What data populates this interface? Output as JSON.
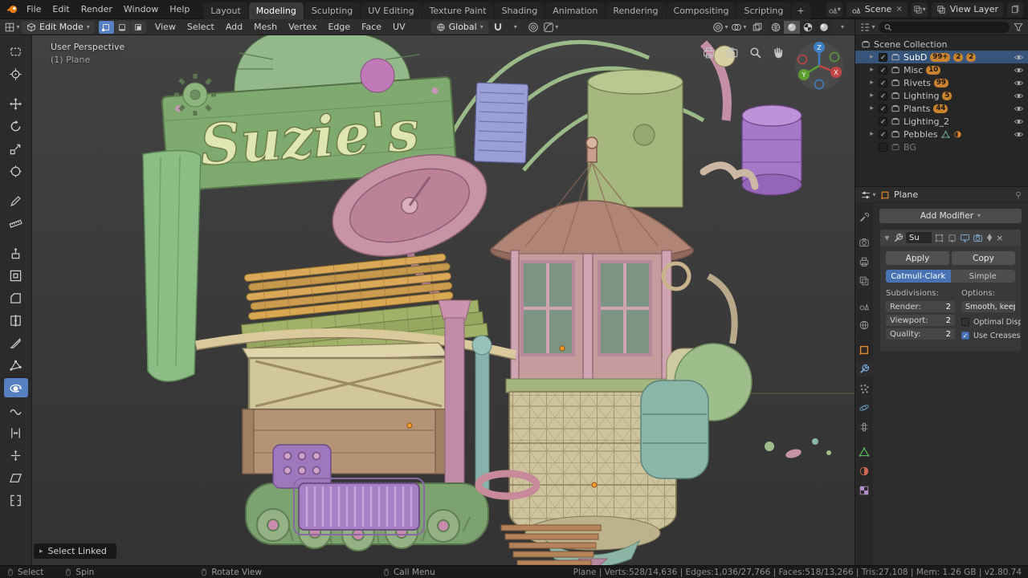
{
  "colors": {
    "accent": "#4772b3",
    "selection_row": "#37557c",
    "active_tool": "#5680c2",
    "badge": "#c9822e"
  },
  "topbar": {
    "menus": [
      "File",
      "Edit",
      "Render",
      "Window",
      "Help"
    ],
    "workspaces": [
      "Layout",
      "Modeling",
      "Sculpting",
      "UV Editing",
      "Texture Paint",
      "Shading",
      "Animation",
      "Rendering",
      "Compositing",
      "Scripting"
    ],
    "active_workspace": "Modeling",
    "add_workspace_label": "+",
    "scene": {
      "label": "Scene"
    },
    "view_layer": {
      "label": "View Layer"
    }
  },
  "view_header": {
    "mode": "Edit Mode",
    "menus": [
      "View",
      "Select",
      "Add",
      "Mesh",
      "Vertex",
      "Edge",
      "Face",
      "UV"
    ],
    "orientation": "Global"
  },
  "toolbar": {
    "active_tool": "spin",
    "tools": [
      "select-box",
      "cursor",
      "move",
      "rotate",
      "scale",
      "transform",
      "annotate",
      "measure",
      "extrude-region",
      "inset-faces",
      "bevel",
      "loop-cut",
      "knife",
      "poly-build",
      "spin",
      "smooth",
      "edge-slide",
      "shrink-fatten",
      "shear",
      "rip-region"
    ]
  },
  "viewport": {
    "overlay_line1": "User Perspective",
    "overlay_line2": "(1) Plane",
    "sign_text": "Suzie's",
    "select_linked_label": "Select Linked",
    "gizmo_axes": {
      "x": "X",
      "y": "Y",
      "z": "Z"
    }
  },
  "outliner": {
    "root_label": "Scene Collection",
    "items": [
      {
        "label": "SubD",
        "badges": [
          "99+",
          "2",
          "2"
        ],
        "selected": true
      },
      {
        "label": "Misc",
        "badges": [
          "10"
        ]
      },
      {
        "label": "Rivets",
        "badges": [
          "99"
        ]
      },
      {
        "label": "Lighting",
        "badges": [
          "5"
        ]
      },
      {
        "label": "Plants",
        "badges": [
          "44"
        ]
      },
      {
        "label": "Lighting_2",
        "badges": []
      },
      {
        "label": "Pebbles",
        "badges": []
      },
      {
        "label": "BG",
        "badges": []
      }
    ]
  },
  "properties": {
    "breadcrumb": "Plane",
    "add_modifier_label": "Add Modifier",
    "tabs": [
      "tool",
      "render",
      "output",
      "view-layer",
      "scene",
      "world",
      "object",
      "modifiers",
      "particles",
      "physics",
      "constraints",
      "object-data",
      "material",
      "texture"
    ],
    "active_tab": "modifiers",
    "modifier": {
      "name": "Su",
      "apply_label": "Apply",
      "copy_label": "Copy",
      "type_options": [
        "Catmull-Clark",
        "Simple"
      ],
      "active_type": "Catmull-Clark",
      "subdivisions_label": "Subdivisions:",
      "options_label": "Options:",
      "fields": [
        {
          "label": "Render:",
          "value": "2"
        },
        {
          "label": "Viewport:",
          "value": "2"
        },
        {
          "label": "Quality:",
          "value": "2"
        }
      ],
      "smoothing_dropdown": "Smooth, keep c...",
      "optimal_display_label": "Optimal Displ..",
      "use_creases_label": "Use Creases",
      "use_creases_checked": true
    }
  },
  "statusbar": {
    "hints": [
      {
        "label": "Select"
      },
      {
        "label": "Spin"
      },
      {
        "label": "Rotate View"
      },
      {
        "label": "Call Menu"
      }
    ],
    "stats": "Plane | Verts:528/14,636 | Edges:1,036/27,766 | Faces:518/13,266 | Tris:27,108 | Mem: 1.26 GB | v2.80.74"
  }
}
